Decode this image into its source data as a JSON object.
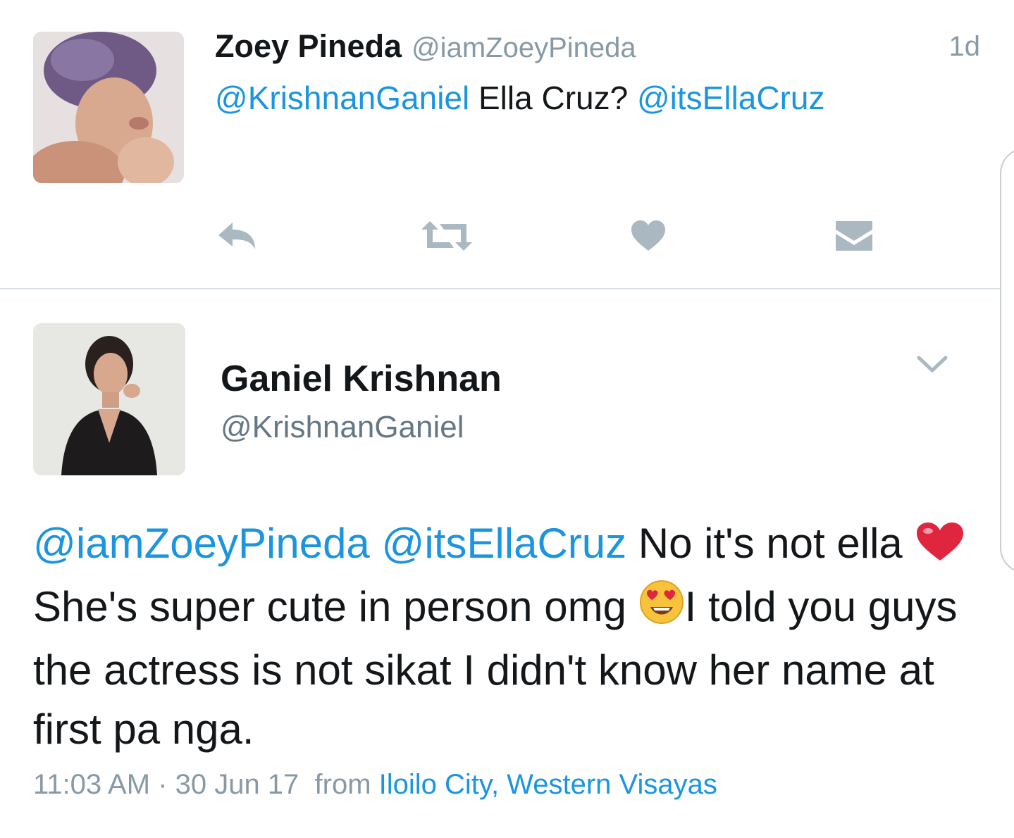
{
  "tweet1": {
    "name": "Zoey Pineda",
    "handle": "@iamZoeyPineda",
    "time": "1d",
    "text": {
      "mention1": "@KrishnanGaniel",
      "plain": " Ella Cruz? ",
      "mention2": "@itsEllaCruz"
    },
    "actions": [
      "reply-icon",
      "retweet-icon",
      "like-icon",
      "message-icon"
    ]
  },
  "tweet2": {
    "name": "Ganiel Krishnan",
    "handle": "@KrishnanGaniel",
    "body": {
      "mention1": "@iamZoeyPineda",
      "mention2": "@itsEllaCruz",
      "text1": " No it's not ella ",
      "text2": " She's super cute in person omg ",
      "text3": "I told you guys the actress is not sikat I didn't know her name at first pa nga."
    },
    "meta": {
      "time": "11:03 AM",
      "separator": " · ",
      "date": "30 Jun 17",
      "from": "from ",
      "location": "Iloilo City, Western Visayas"
    }
  },
  "colors": {
    "link": "#1b95e0",
    "muted": "#8899a6",
    "icon": "#aab8c2",
    "heart_emoji": "#e0263e"
  }
}
